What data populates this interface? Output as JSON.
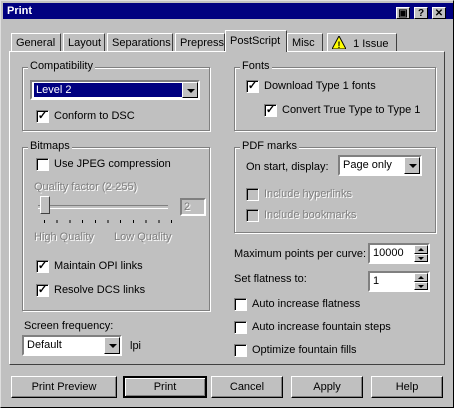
{
  "window": {
    "title": "Print",
    "controls": [
      "▣",
      "?",
      "✕"
    ]
  },
  "tabs": [
    {
      "label": "General"
    },
    {
      "label": "Layout"
    },
    {
      "label": "Separations"
    },
    {
      "label": "Prepress"
    },
    {
      "label": "PostScript"
    },
    {
      "label": "Misc"
    },
    {
      "label": "1 Issue"
    }
  ],
  "compatibility": {
    "group_label": "Compatibility",
    "level_value": "Level 2",
    "conform_dsc": {
      "label": "Conform to DSC",
      "checked": true
    }
  },
  "fonts": {
    "group_label": "Fonts",
    "download_type1": {
      "label": "Download Type 1 fonts",
      "checked": true
    },
    "convert_truetype": {
      "label": "Convert True Type to Type 1",
      "checked": true
    }
  },
  "bitmaps": {
    "group_label": "Bitmaps",
    "jpeg": {
      "label": "Use JPEG compression",
      "checked": false
    },
    "quality_label": "Quality factor (2-255)",
    "quality_value": "2",
    "high_quality": "High Quality",
    "low_quality": "Low Quality",
    "maintain_opi": {
      "label": "Maintain OPI links",
      "checked": true
    },
    "resolve_dcs": {
      "label": "Resolve DCS links",
      "checked": true
    }
  },
  "pdf_marks": {
    "group_label": "PDF marks",
    "on_start_label": "On start, display:",
    "on_start_value": "Page only",
    "include_hyperlinks": {
      "label": "Include hyperlinks",
      "checked": false
    },
    "include_bookmarks": {
      "label": "Include bookmarks",
      "checked": false
    }
  },
  "curve": {
    "label": "Maximum points per curve:",
    "value": "10000"
  },
  "flatness": {
    "label": "Set flatness to:",
    "value": "1"
  },
  "auto_flatness": {
    "label": "Auto increase flatness",
    "checked": false
  },
  "auto_fountain": {
    "label": "Auto increase fountain steps",
    "checked": false
  },
  "optimize_fountain": {
    "label": "Optimize fountain fills",
    "checked": false
  },
  "screen": {
    "label": "Screen frequency:",
    "value": "Default",
    "unit": "lpi"
  },
  "buttons": {
    "preview": "Print Preview",
    "print": "Print",
    "cancel": "Cancel",
    "apply": "Apply",
    "help": "Help"
  }
}
